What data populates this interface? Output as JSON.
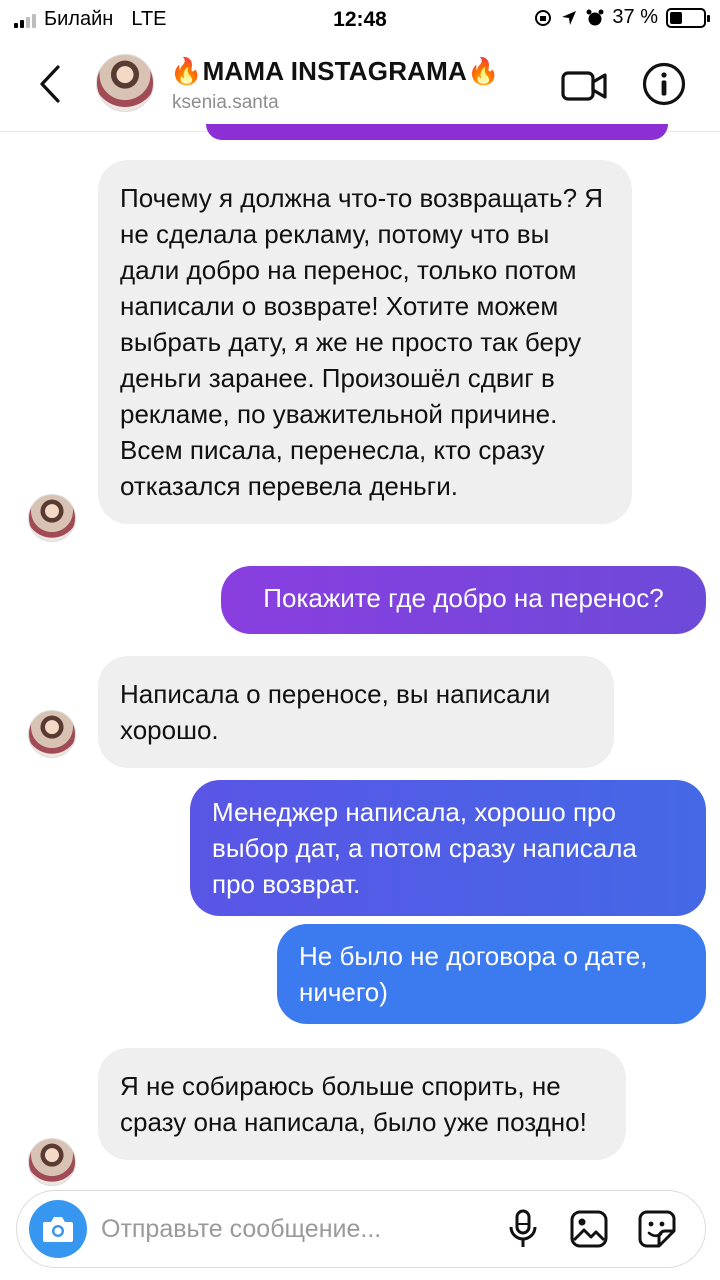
{
  "status_bar": {
    "carrier": "Билайн",
    "network": "LTE",
    "time": "12:48",
    "battery": "37 %",
    "battery_level": 0.37
  },
  "header": {
    "contact_name": "🔥MAMA INSTAGRAMA🔥",
    "username": "ksenia.santa"
  },
  "messages": [
    {
      "direction": "incoming",
      "text": "Почему я должна что-то возвращать? Я не сделала рекламу, потому что вы дали добро на перенос, только потом написали о возврате! Хотите можем выбрать дату, я же не просто так беру деньги заранее. Произошёл сдвиг в рекламе, по уважительной причине. Всем писала, перенесла, кто сразу отказался перевела деньги."
    },
    {
      "direction": "outgoing",
      "text": "Покажите где добро на перенос?"
    },
    {
      "direction": "incoming",
      "text": "Написала о переносе, вы написали хорошо."
    },
    {
      "direction": "outgoing",
      "text": "Менеджер написала, хорошо про выбор дат, а потом сразу написала про возврат."
    },
    {
      "direction": "outgoing",
      "text": "Не было не договора о дате, ничего)"
    },
    {
      "direction": "incoming",
      "text": "Я не собираюсь больше спорить, не сразу она написала, было уже поздно!"
    }
  ],
  "composer": {
    "placeholder": "Отправьте сообщение..."
  },
  "colors": {
    "outgoing_purple": "#7a3fe0",
    "outgoing_blue": "#4267e6",
    "outgoing_lightblue": "#3b79ef",
    "incoming_bg": "#efefef",
    "camera_blue": "#3797f0"
  },
  "icons": [
    "back-chevron-icon",
    "video-call-icon",
    "info-icon",
    "camera-icon",
    "microphone-icon",
    "gallery-icon",
    "sticker-icon"
  ]
}
